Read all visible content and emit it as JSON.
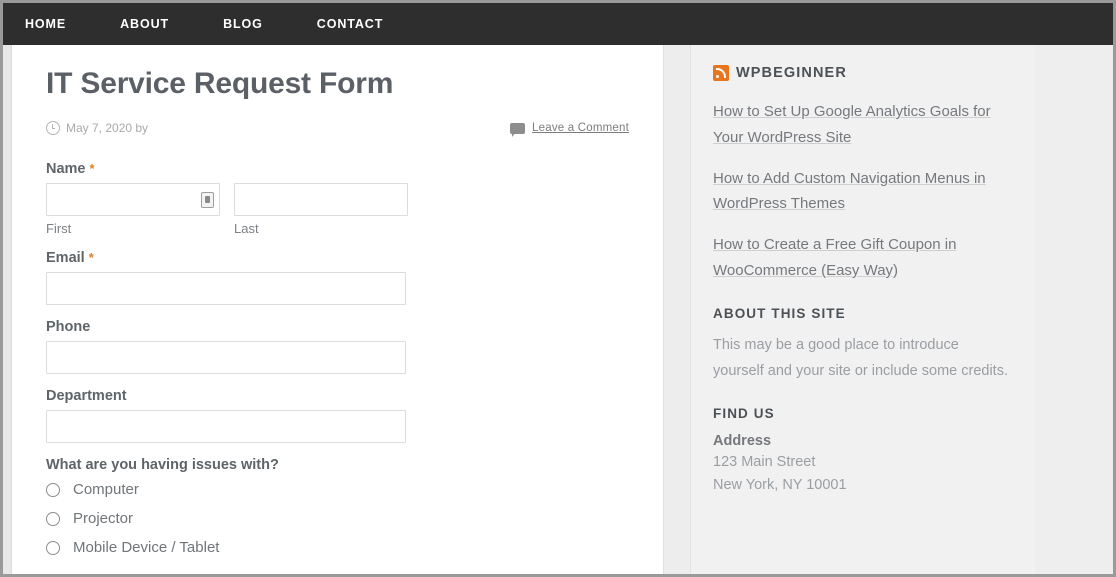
{
  "nav": {
    "items": [
      {
        "label": "HOME",
        "name": "nav-item-home"
      },
      {
        "label": "ABOUT",
        "name": "nav-item-about"
      },
      {
        "label": "BLOG",
        "name": "nav-item-blog"
      },
      {
        "label": "CONTACT",
        "name": "nav-item-contact"
      }
    ]
  },
  "article": {
    "title": "IT Service Request Form",
    "date": "May 7, 2020 by",
    "comment_link": "Leave a Comment",
    "clock_icon": "clock-icon",
    "comment_icon": "comment-bubble-icon"
  },
  "form": {
    "name": {
      "label": "Name",
      "required_marker": "*",
      "first_sub_label": "First",
      "last_sub_label": "Last",
      "first_value": "",
      "last_value": "",
      "autofill_icon": "contact-card-icon"
    },
    "email": {
      "label": "Email",
      "required_marker": "*",
      "value": ""
    },
    "phone": {
      "label": "Phone",
      "value": ""
    },
    "department": {
      "label": "Department",
      "value": ""
    },
    "issue": {
      "prompt": "What are you having issues with?",
      "options": [
        {
          "label": "Computer"
        },
        {
          "label": "Projector"
        },
        {
          "label": "Mobile Device / Tablet"
        }
      ]
    }
  },
  "sidebar": {
    "feed_widget": {
      "title": "WPBEGINNER",
      "icon": "rss-icon",
      "links": [
        "How to Set Up Google Analytics Goals for Your WordPress Site",
        "How to Add Custom Navigation Menus in WordPress Themes",
        "How to Create a Free Gift Coupon in WooCommerce (Easy Way)"
      ]
    },
    "about_widget": {
      "title": "ABOUT THIS SITE",
      "text": "This may be a good place to introduce yourself and your site or include some credits."
    },
    "find_us_widget": {
      "title": "FIND US",
      "address_label": "Address",
      "address_line1": "123 Main Street",
      "address_line2": "New York, NY 10001"
    }
  },
  "colors": {
    "nav_bg": "#2e2e2e",
    "accent_orange": "#d9822b",
    "rss_orange": "#e8741e",
    "heading": "#5b5f66"
  }
}
